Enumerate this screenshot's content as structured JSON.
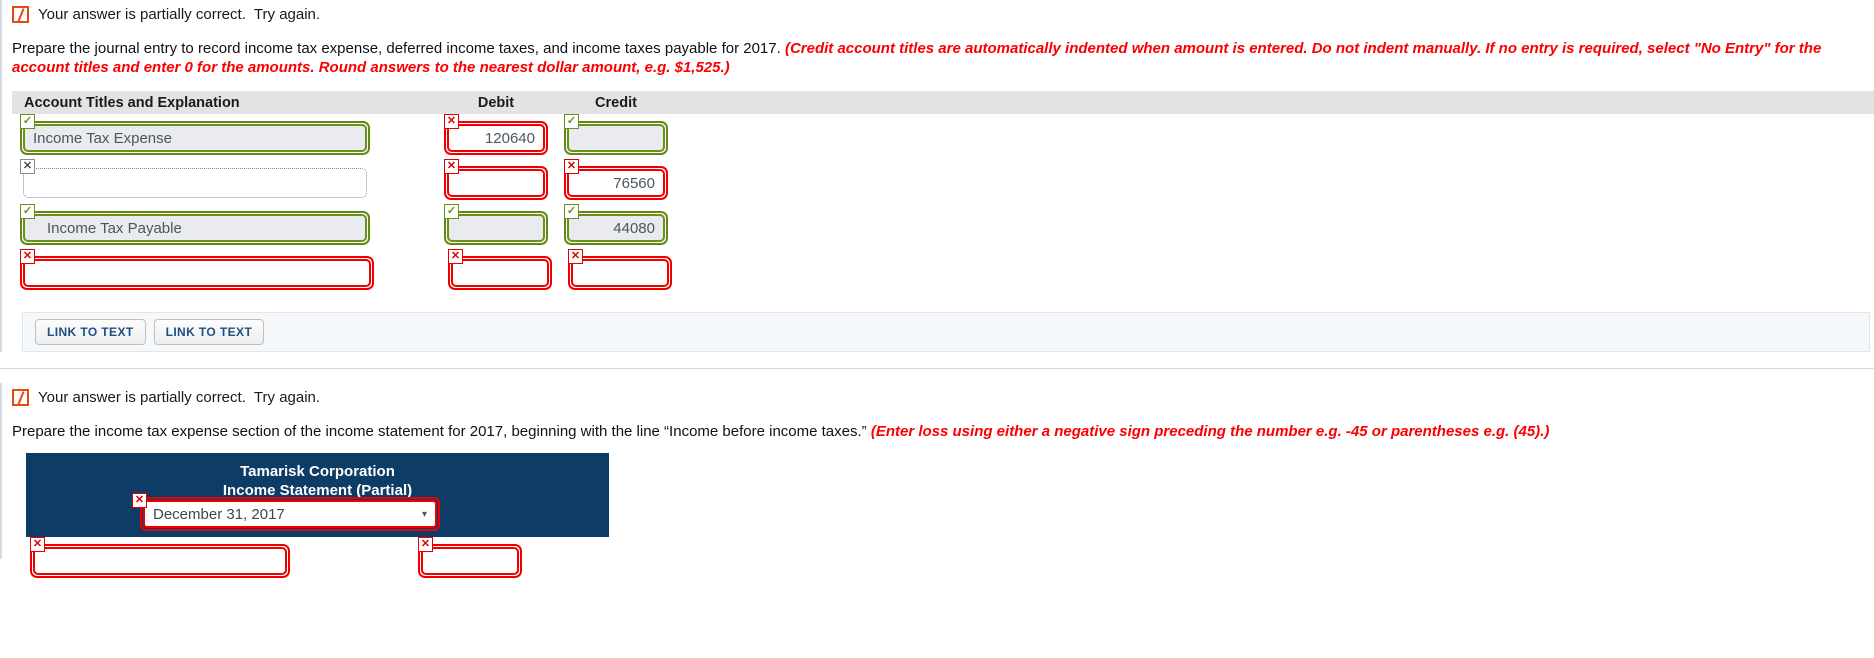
{
  "question1": {
    "status": {
      "icon": "partial-correct-icon",
      "text": "Your answer is partially correct.  Try again."
    },
    "prompt_main": "Prepare the journal entry to record income tax expense, deferred income taxes, and income taxes payable for 2017.",
    "prompt_note": "(Credit account titles are automatically indented when amount is entered. Do not indent manually. If no entry is required, select \"No Entry\" for the account titles and enter 0 for the amounts. Round answers to the nearest dollar amount, e.g. $1,525.)",
    "table": {
      "headers": {
        "account": "Account Titles and Explanation",
        "debit": "Debit",
        "credit": "Credit"
      },
      "rows": [
        {
          "account": {
            "value": "Income Tax Expense",
            "state": "ok",
            "badge": "✓",
            "indent": false
          },
          "debit": {
            "value": "120640",
            "state": "bad",
            "badge": "✕"
          },
          "credit": {
            "value": "",
            "state": "ok",
            "badge": "✓"
          }
        },
        {
          "account": {
            "value": "",
            "state": "dim",
            "badge": "✕",
            "indent": false
          },
          "debit": {
            "value": "",
            "state": "bad",
            "badge": "✕"
          },
          "credit": {
            "value": "76560",
            "state": "bad",
            "badge": "✕"
          }
        },
        {
          "account": {
            "value": "Income Tax Payable",
            "state": "ok",
            "badge": "✓",
            "indent": true
          },
          "debit": {
            "value": "",
            "state": "ok",
            "badge": "✓"
          },
          "credit": {
            "value": "44080",
            "state": "ok",
            "badge": "✓"
          }
        },
        {
          "account": {
            "value": "",
            "state": "bad",
            "badge": "✕",
            "indent": false
          },
          "debit": {
            "value": "",
            "state": "bad",
            "badge": "✕"
          },
          "credit": {
            "value": "",
            "state": "bad",
            "badge": "✕"
          }
        }
      ]
    },
    "link_buttons": [
      "LINK TO TEXT",
      "LINK TO TEXT"
    ]
  },
  "question2": {
    "status": {
      "icon": "partial-correct-icon",
      "text": "Your answer is partially correct.  Try again."
    },
    "prompt_main": "Prepare the income tax expense section of the income statement for 2017, beginning with the line “Income before income taxes.”",
    "prompt_note": "(Enter loss using either a negative sign preceding the number e.g. -45 or parentheses e.g. (45).)",
    "statement": {
      "company": "Tamarisk Corporation",
      "title": "Income Statement (Partial)",
      "period_select": {
        "value": "December 31, 2017",
        "state": "bad",
        "badge": "✕",
        "caret": "▾"
      },
      "partial_rows": [
        {
          "account": {
            "value": "",
            "state": "bad",
            "badge": "✕"
          },
          "amount": {
            "value": "",
            "state": "bad",
            "badge": "✕"
          }
        }
      ]
    }
  },
  "colors": {
    "correct": "#6a9117",
    "incorrect": "#f10000",
    "note_red": "#fa0000",
    "header_bg": "#e3e3e3",
    "statement_bg": "#0d3c67",
    "link_text": "#1c4f82"
  }
}
